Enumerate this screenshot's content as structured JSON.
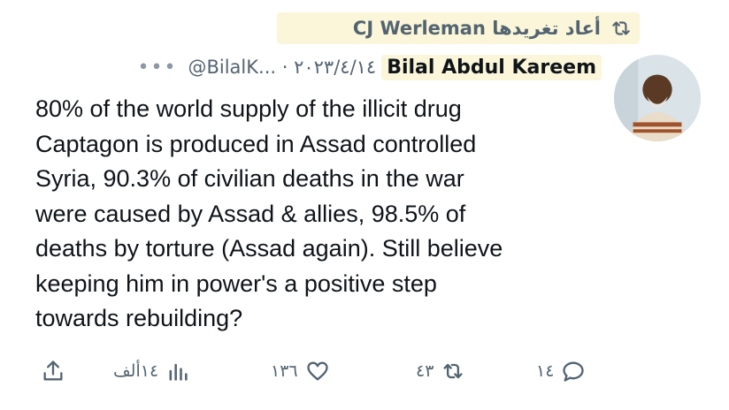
{
  "retweet": {
    "label": "أعاد تغريدها CJ Werleman",
    "icon": "retweet-icon"
  },
  "tweet": {
    "author_name": "Bilal Abdul Kareem",
    "handle_date": "@BilalK... · ٢٠٢٣/٤/١٤",
    "more": "•••",
    "lines": [
      "80% of the world supply of the illicit drug",
      "Captagon is produced in Assad controlled",
      "Syria, 90.3% of civilian deaths in the war",
      "were caused by Assad & allies, 98.5% of",
      "deaths by torture (Assad again).  Still believe",
      "keeping him in power's a positive step",
      "towards rebuilding?"
    ]
  },
  "actions": {
    "replies": "١٤",
    "retweets": "٤٣",
    "likes": "١٣٦",
    "views": "١٤ألف"
  },
  "colors": {
    "highlight": "#fbf6d9",
    "icon": "#536471",
    "text": "#0f1419"
  }
}
